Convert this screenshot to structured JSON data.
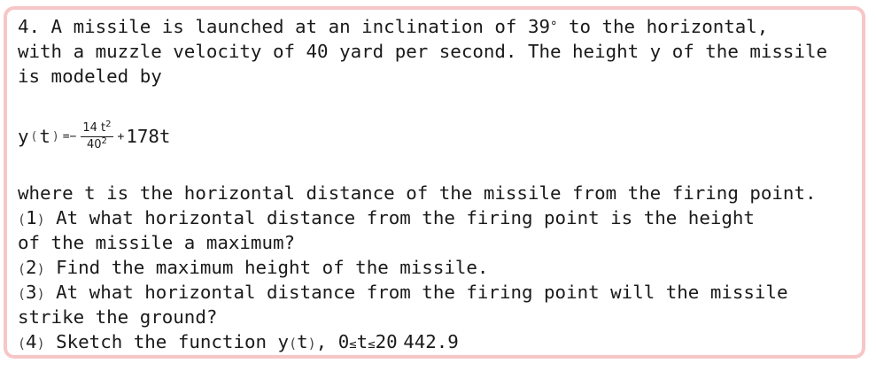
{
  "problem": {
    "intro_line1": "4. A missile is launched at an inclination of 39",
    "degree_symbol": "°",
    "intro_line1_tail": " to the horizontal,",
    "intro_line2": "with a muzzle velocity of 40 yard per second. The height y of the missile",
    "intro_line3": "is modeled by",
    "formula": {
      "lhs_var": "y",
      "lparen": "(",
      "arg": "t",
      "rparen": ")",
      "equals_minus": "=−",
      "numerator_coef": "14 t",
      "numerator_exp": "2",
      "denominator_base": "40",
      "denominator_exp": "2",
      "plus": "+",
      "linear_term": "178t"
    },
    "where_line": "where t is the horizontal distance of the missile from the firing point.",
    "q1": {
      "num": "1",
      "text_line1": " At what horizontal distance from the firing point is the height",
      "text_line2": "of the missile a maximum?"
    },
    "q2": {
      "num": "2",
      "text": " Find the maximum height of the missile."
    },
    "q3": {
      "num": "3",
      "text_line1": " At what horizontal distance from the firing point will the missile",
      "text_line2": "strike the ground?"
    },
    "q4": {
      "num": "4",
      "text": " Sketch the function y",
      "arg": "t",
      "comma": ", 0",
      "le1": "≤",
      "t": "t",
      "le2": "≤",
      "upper_a": "20",
      "upper_b": "442.9"
    }
  }
}
